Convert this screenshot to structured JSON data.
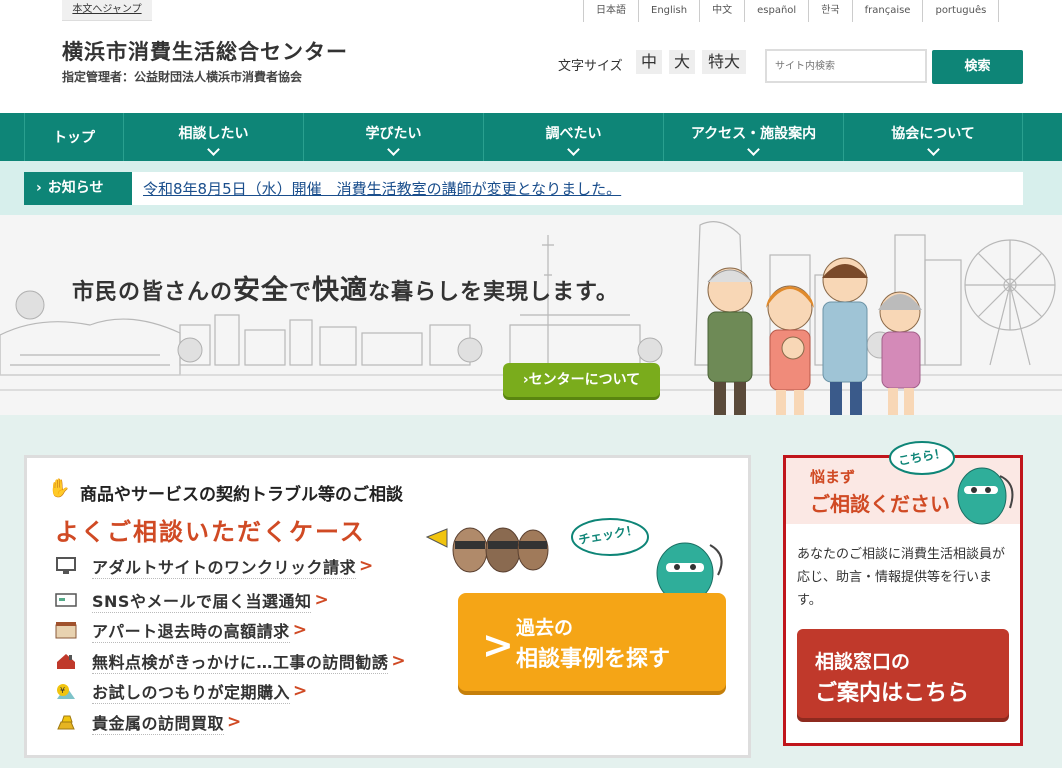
{
  "header": {
    "skip_link": "本文へジャンプ",
    "languages": [
      "日本語",
      "English",
      "中文",
      "español",
      "한국",
      "française",
      "português"
    ],
    "site_title": "横浜市消費生活総合センター",
    "site_subtitle": "指定管理者：公益財団法人横浜市消費者協会",
    "font_size_label": "文字サイズ",
    "font_sizes": [
      "中",
      "大",
      "特大"
    ],
    "search_placeholder": "サイト内検索",
    "search_button": "検索"
  },
  "nav": {
    "items": [
      {
        "label": "トップ"
      },
      {
        "label": "相談したい"
      },
      {
        "label": "学びたい"
      },
      {
        "label": "調べたい"
      },
      {
        "label": "アクセス・施設案内"
      },
      {
        "label": "協会について"
      }
    ]
  },
  "news": {
    "label": "お知らせ",
    "text": "令和8年8月5日（水）開催　消費生活教室の講師が変更となりました。"
  },
  "hero": {
    "tagline_parts": [
      "市民の皆さんの",
      "安全",
      "で",
      "快適",
      "な暮らしを実現します。"
    ],
    "about_button": "センターについて"
  },
  "consult": {
    "heading": "商品やサービスの契約トラブル等のご相談",
    "cases_heading": "よくご相談いただくケース",
    "cases": [
      {
        "label": "アダルトサイトのワンクリック請求",
        "icon": "monitor-icon"
      },
      {
        "label": "SNSやメールで届く当選通知",
        "icon": "card-icon"
      },
      {
        "label": "アパート退去時の高額請求",
        "icon": "building-icon"
      },
      {
        "label": "無料点検がきっかけに…工事の訪問勧誘",
        "icon": "house-icon"
      },
      {
        "label": "お試しのつもりが定期購入",
        "icon": "yen-icon"
      },
      {
        "label": "貴金属の訪問買取",
        "icon": "gold-icon"
      }
    ],
    "check_bubble": "チェック！",
    "search_cases_line1": "過去の",
    "search_cases_line2": "相談事例を探す"
  },
  "side": {
    "bubble": "こちら！",
    "title_line1": "悩まず",
    "title_line2": "ご相談ください",
    "description": "あなたのご相談に消費生活相談員が応じ、助言・情報提供等を行います。",
    "contact_line1": "相談窓口の",
    "contact_line2": "ご案内はこちら"
  },
  "colors": {
    "brand_green": "#0e8577",
    "accent_red": "#d04a24",
    "orange": "#f5a516",
    "lime": "#7aac1c"
  }
}
